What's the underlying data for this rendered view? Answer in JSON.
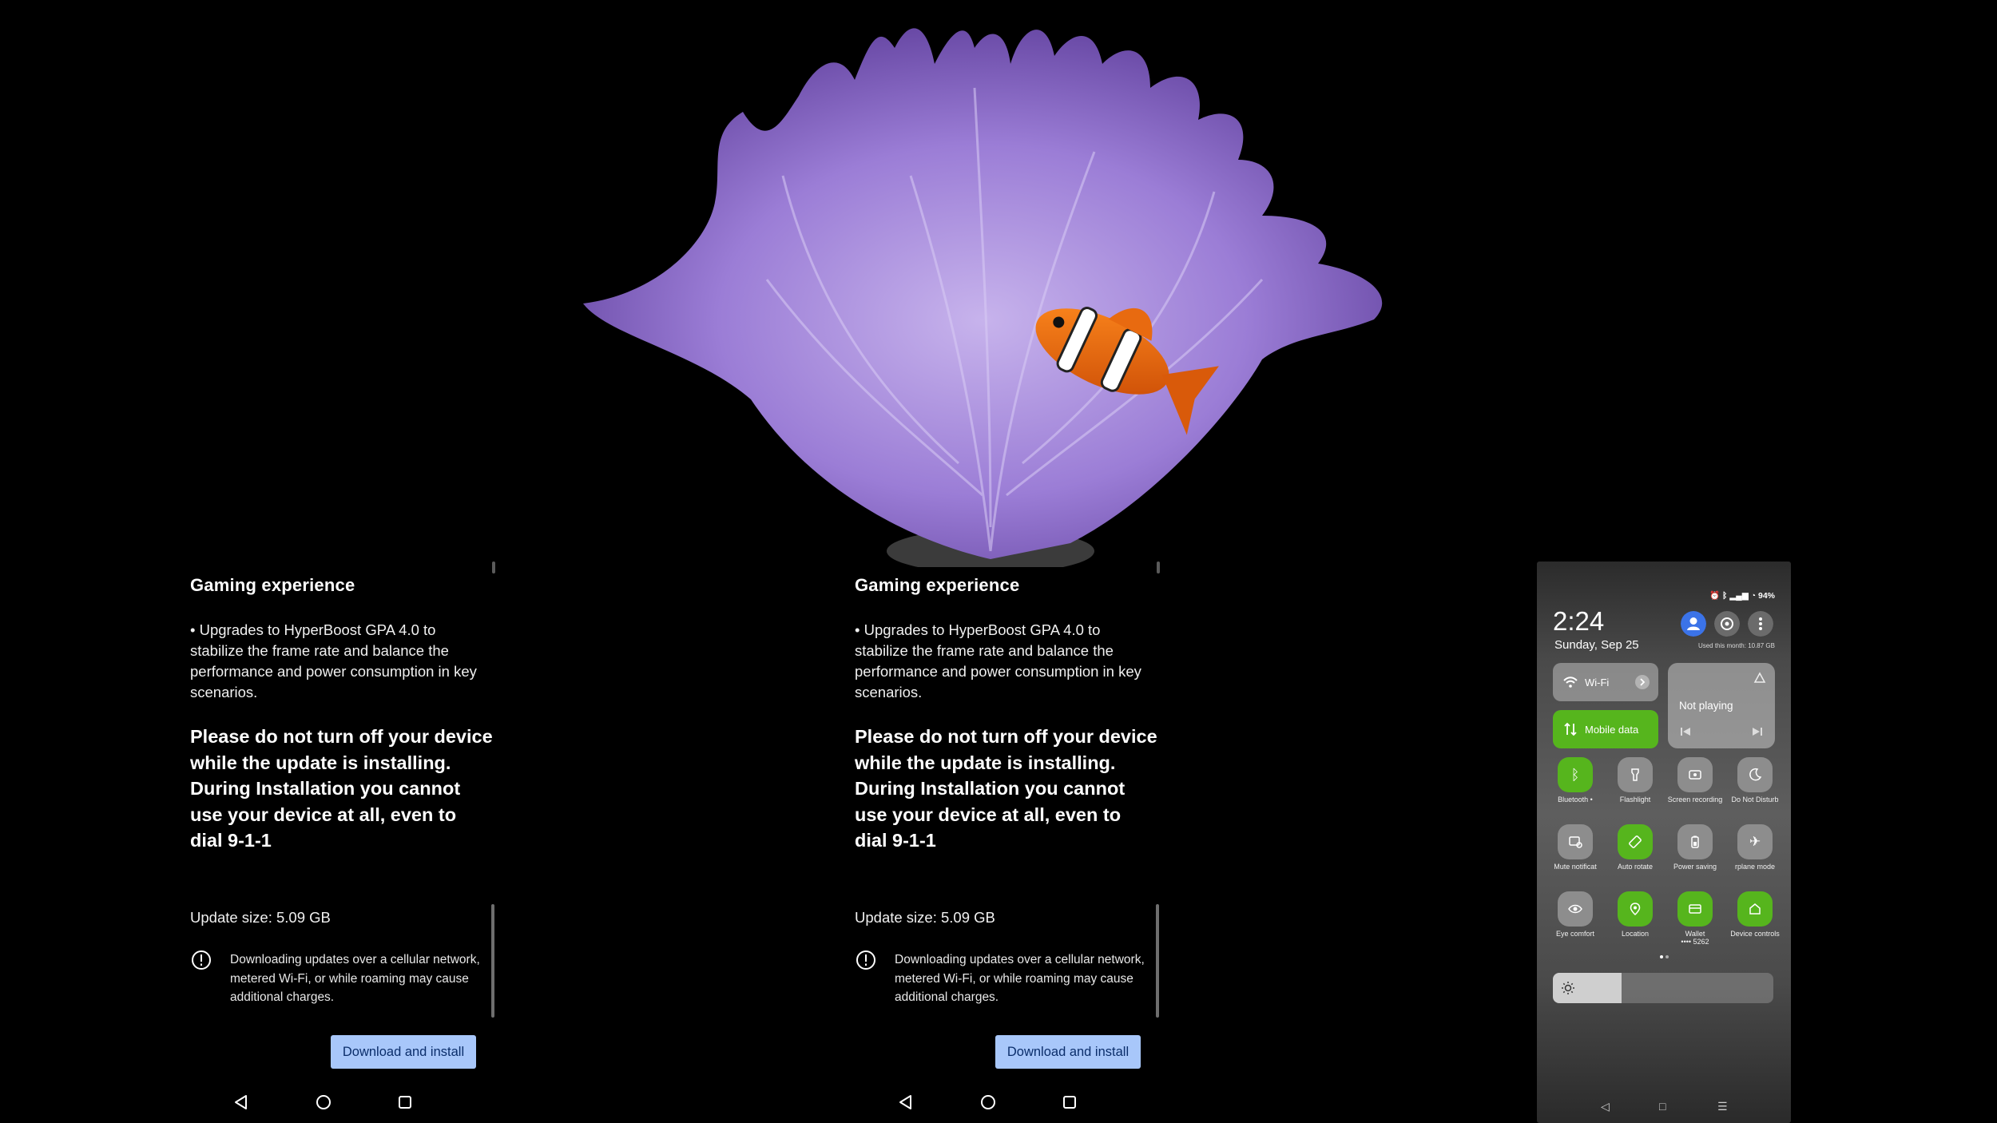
{
  "update_panels": [
    {
      "heading": "Gaming experience",
      "bullet": "• Upgrades to HyperBoost GPA 4.0 to stabilize the frame rate and balance the performance and power consumption in key scenarios.",
      "warning": "Please do not turn off your device while the update is installing. During Installation you cannot use your device at all, even to dial 9-1-1",
      "update_size": "Update size: 5.09 GB",
      "note": "Downloading updates over a cellular network, metered Wi-Fi, or while roaming may cause additional charges.",
      "button": "Download and install"
    },
    {
      "heading": "Gaming experience",
      "bullet": "• Upgrades to HyperBoost GPA 4.0 to stabilize the frame rate and balance the performance and power consumption in key scenarios.",
      "warning": "Please do not turn off your device while the update is installing. During Installation you cannot use your device at all, even to dial 9-1-1",
      "update_size": "Update size: 5.09 GB",
      "note": "Downloading updates over a cellular network, metered Wi-Fi, or while roaming may cause additional charges.",
      "button": "Download and install"
    }
  ],
  "icons": {
    "nav": [
      "back-icon",
      "home-icon",
      "recents-icon"
    ],
    "info": "info-icon"
  },
  "control_center": {
    "status": "94%",
    "time": "2:24",
    "date": "Sunday, Sep 25",
    "data_used": "Used this month: 10.87 GB",
    "wifi_label": "Wi-Fi",
    "mobile_data_label": "Mobile data",
    "media_label": "Not playing",
    "tiles": [
      {
        "label": "Bluetooth •",
        "icon": "bluetooth-icon",
        "on": true
      },
      {
        "label": "Flashlight",
        "icon": "flashlight-icon",
        "on": false
      },
      {
        "label": "Screen recording",
        "icon": "screen-record-icon",
        "on": false
      },
      {
        "label": "Do Not Disturb",
        "icon": "moon-icon",
        "on": false
      },
      {
        "label": "Mute notificat",
        "icon": "mute-notification-icon",
        "on": false
      },
      {
        "label": "Auto rotate",
        "icon": "auto-rotate-icon",
        "on": true
      },
      {
        "label": "Power saving",
        "icon": "battery-icon",
        "on": false
      },
      {
        "label": "rplane mode",
        "icon": "airplane-icon",
        "on": false
      },
      {
        "label": "Eye comfort",
        "icon": "eye-icon",
        "on": false
      },
      {
        "label": "Location",
        "icon": "location-icon",
        "on": true
      },
      {
        "label": "Wallet",
        "sublabel": "•••• 5262",
        "icon": "wallet-icon",
        "on": true
      },
      {
        "label": "Device controls",
        "icon": "home-icon",
        "on": true
      }
    ],
    "brightness_fraction": 0.31,
    "colors": {
      "accent_green": "#56b51d",
      "account_blue": "#3b73e8",
      "button_blue": "#a8c7fa"
    }
  }
}
